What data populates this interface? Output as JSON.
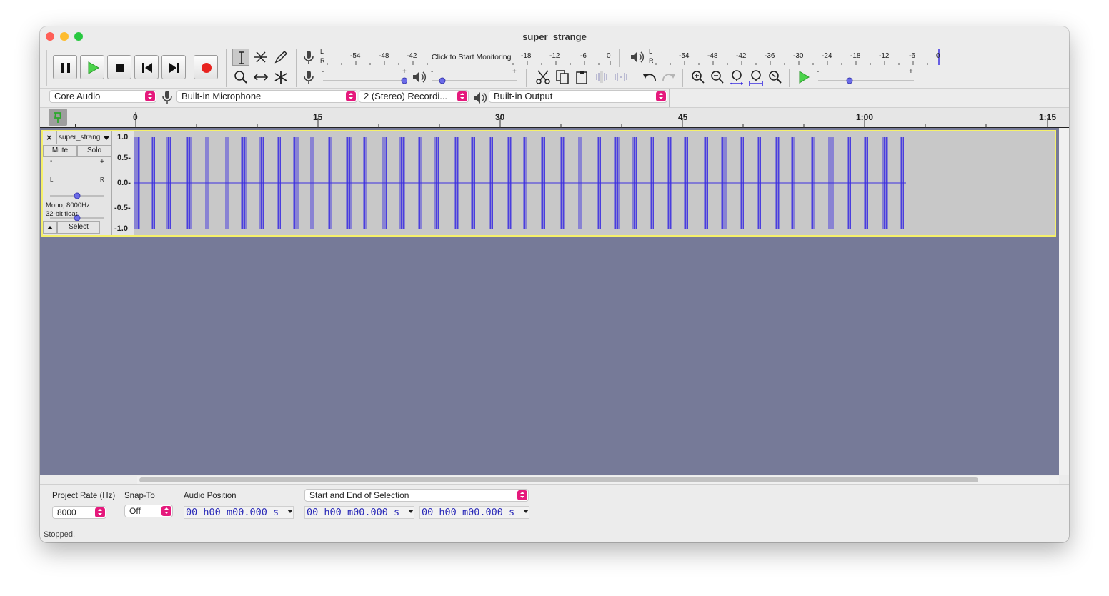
{
  "window": {
    "title": "super_strange"
  },
  "transport": {
    "pause_label": "Pause",
    "play_label": "Play",
    "stop_label": "Stop",
    "skip_start_label": "Skip to Start",
    "skip_end_label": "Skip to End",
    "record_label": "Record"
  },
  "meters": {
    "record_channel_l": "L",
    "record_channel_r": "R",
    "record_ticks": [
      "-54",
      "-48",
      "-42",
      "-18",
      "-12",
      "-6",
      "0"
    ],
    "monitor_label": "Click to Start Monitoring",
    "play_channel_l": "L",
    "play_channel_r": "R",
    "play_ticks": [
      "-54",
      "-48",
      "-42",
      "-36",
      "-30",
      "-24",
      "-18",
      "-12",
      "-6",
      "0"
    ],
    "slider_minus": "-",
    "slider_plus": "+"
  },
  "device": {
    "host": "Core Audio",
    "input": "Built-in Microphone",
    "channels": "2 (Stereo) Recordi...",
    "output": "Built-in Output"
  },
  "ruler": {
    "labels": [
      "0",
      "15",
      "30",
      "45",
      "1:00",
      "1:15"
    ]
  },
  "track": {
    "name": "super_strang",
    "close_glyph": "×",
    "mute_label": "Mute",
    "solo_label": "Solo",
    "gain_minus": "-",
    "gain_plus": "+",
    "pan_left": "L",
    "pan_right": "R",
    "info_line1": "Mono, 8000Hz",
    "info_line2": "32-bit float",
    "select_label": "Select",
    "scale": [
      "1.0",
      "0.5-",
      "0.0-",
      "-0.5-",
      "-1.0"
    ]
  },
  "selection_bar": {
    "project_rate_label": "Project Rate (Hz)",
    "project_rate_value": "8000",
    "snap_to_label": "Snap-To",
    "snap_to_value": "Off",
    "audio_position_label": "Audio Position",
    "selection_mode": "Start and End of Selection",
    "tc_h": "00",
    "tc_m": "00",
    "tc_s": "00.000",
    "unit_h": "h",
    "unit_m": "m",
    "unit_s": "s"
  },
  "status": {
    "text": "Stopped."
  },
  "colors": {
    "waveform": "#3b2ee0",
    "workspace": "#767a98",
    "accent": "#e5197c",
    "track_bg": "#c8c8c8",
    "selected_border": "#f5f06a"
  }
}
